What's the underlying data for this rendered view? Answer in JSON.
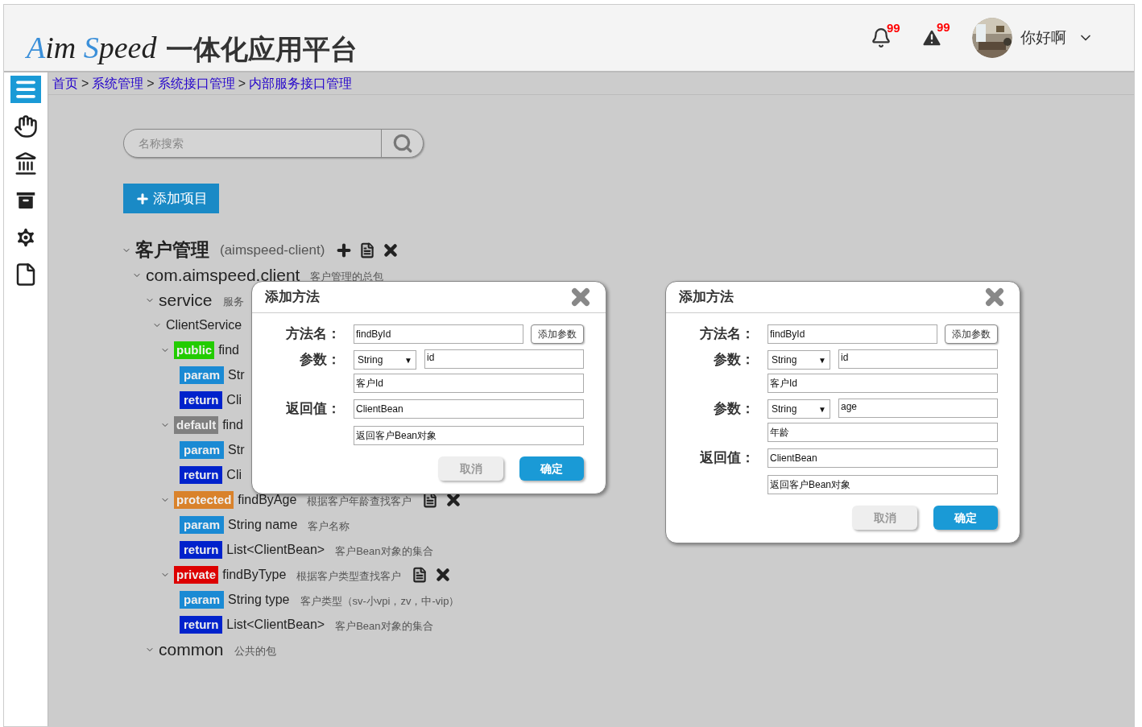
{
  "header": {
    "logo": [
      {
        "text": "A",
        "accent": true
      },
      {
        "text": "im ",
        "accent": false
      },
      {
        "text": "S",
        "accent": true
      },
      {
        "text": "peed",
        "accent": false
      }
    ],
    "title": "一体化应用平台",
    "alerts": [
      {
        "kind": "bell",
        "count": "99"
      },
      {
        "kind": "warning",
        "count": "99"
      }
    ],
    "user": {
      "name": "你好啊"
    }
  },
  "sidebar": {
    "items": [
      {
        "kind": "list",
        "selected": true
      },
      {
        "kind": "hand",
        "selected": false
      },
      {
        "kind": "bank",
        "selected": false
      },
      {
        "kind": "archive",
        "selected": false
      },
      {
        "kind": "gears",
        "selected": false
      },
      {
        "kind": "file",
        "selected": false
      }
    ]
  },
  "breadcrumb": {
    "separator": ">",
    "items": [
      "首页",
      "系统管理",
      "系统接口管理",
      "内部服务接口管理"
    ]
  },
  "search": {
    "placeholder": "名称搜索"
  },
  "add_button": {
    "label": "添加项目"
  },
  "tree": [
    {
      "kind": "project",
      "label": "客户管理",
      "note": "(aimspeed-client)",
      "expanded": true,
      "actions": [
        {
          "kind": "add"
        },
        {
          "kind": "doc"
        },
        {
          "kind": "delete"
        }
      ],
      "children": [
        {
          "kind": "package",
          "label": "com.aimspeed.client",
          "note": "客户管理的总包",
          "expanded": true,
          "children": [
            {
              "kind": "package",
              "label": "service",
              "note": "服务",
              "expanded": true,
              "children": [
                {
                  "kind": "class",
                  "label": "ClientService",
                  "expanded": true,
                  "children": [
                    {
                      "kind": "method",
                      "access": "public",
                      "label": "find",
                      "expanded": true,
                      "children": [
                        {
                          "kind": "param",
                          "tag": "param",
                          "label": "Str"
                        },
                        {
                          "kind": "param",
                          "tag": "return",
                          "label": "Cli"
                        }
                      ]
                    },
                    {
                      "kind": "method",
                      "access": "default",
                      "label": "find",
                      "expanded": true,
                      "children": [
                        {
                          "kind": "param",
                          "tag": "param",
                          "label": "Str"
                        },
                        {
                          "kind": "param",
                          "tag": "return",
                          "label": "Cli"
                        }
                      ]
                    },
                    {
                      "kind": "method",
                      "access": "protected",
                      "label": "findByAge",
                      "note": "根据客户年龄查找客户",
                      "actions": [
                        {
                          "kind": "doc"
                        },
                        {
                          "kind": "delete"
                        }
                      ],
                      "expanded": true,
                      "children": [
                        {
                          "kind": "param",
                          "tag": "param",
                          "label": "String name",
                          "note": "客户名称"
                        },
                        {
                          "kind": "param",
                          "tag": "return",
                          "label": "List<ClientBean>",
                          "note": "客户Bean对象的集合"
                        }
                      ]
                    },
                    {
                      "kind": "method",
                      "access": "private",
                      "label": "findByType",
                      "note": "根据客户类型查找客户",
                      "actions": [
                        {
                          "kind": "doc"
                        },
                        {
                          "kind": "delete"
                        }
                      ],
                      "expanded": true,
                      "children": [
                        {
                          "kind": "param",
                          "tag": "param",
                          "label": "String type",
                          "note": "客户类型（sv-小vpi，zv，中-vip）"
                        },
                        {
                          "kind": "param",
                          "tag": "return",
                          "label": "List<ClientBean>",
                          "note": "客户Bean对象的集合"
                        }
                      ]
                    }
                  ]
                }
              ]
            },
            {
              "kind": "package",
              "label": "common",
              "note": "公共的包",
              "expanded": true
            }
          ]
        }
      ]
    }
  ],
  "dialogs": [
    {
      "title": "添加方法",
      "name_label": "方法名：",
      "name_value": "findById",
      "add_param": "添加参数",
      "params": [
        {
          "label": "参数：",
          "type": "String",
          "caret": "▼",
          "name": "id",
          "desc": "客户Id"
        }
      ],
      "return_label": "返回值：",
      "return_type": "ClientBean",
      "return_desc": "返回客户Bean对象",
      "cancel": "取消",
      "ok": "确定"
    },
    {
      "title": "添加方法",
      "name_label": "方法名：",
      "name_value": "findById",
      "add_param": "添加参数",
      "params": [
        {
          "label": "参数：",
          "type": "String",
          "caret": "▼",
          "name": "id",
          "desc": "客户Id"
        },
        {
          "label": "参数：",
          "type": "String",
          "caret": "▼",
          "name": "age",
          "desc": "年龄"
        }
      ],
      "return_label": "返回值：",
      "return_type": "ClientBean",
      "return_desc": "返回客户Bean对象",
      "cancel": "取消",
      "ok": "确定"
    }
  ]
}
